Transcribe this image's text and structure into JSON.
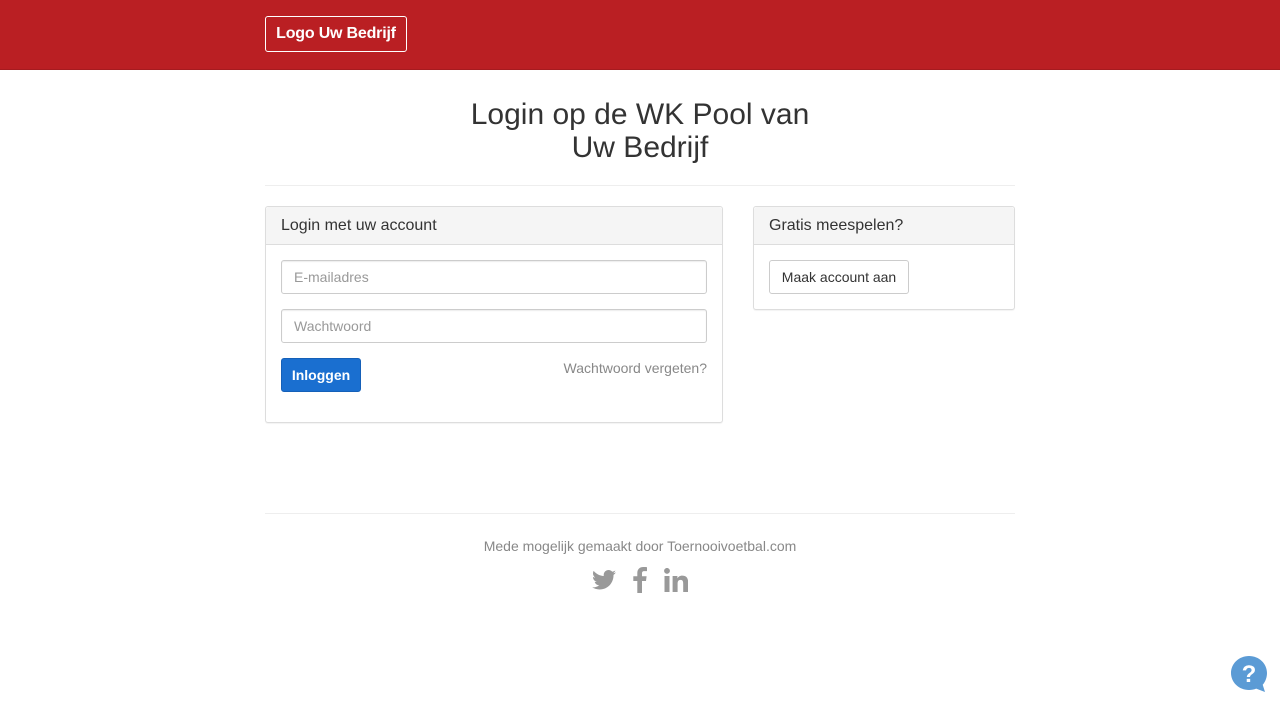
{
  "header": {
    "logo_label": "Logo Uw Bedrijf"
  },
  "title": {
    "line1": "Login op de WK Pool van",
    "line2": "Uw Bedrijf"
  },
  "login_panel": {
    "heading": "Login met uw account",
    "email_placeholder": "E-mailadres",
    "password_placeholder": "Wachtwoord",
    "submit_label": "Inloggen",
    "forgot_label": "Wachtwoord vergeten?"
  },
  "signup_panel": {
    "heading": "Gratis meespelen?",
    "button_label": "Maak account aan"
  },
  "footer": {
    "credit": "Mede mogelijk gemaakt door Toernooivoetbal.com",
    "social_icons": [
      "twitter-icon",
      "facebook-icon",
      "linkedin-icon"
    ]
  },
  "colors": {
    "header_bg": "#ba1f23",
    "primary": "#1a6fd0",
    "help": "#5b9bd5"
  },
  "help_icon": "question-icon"
}
